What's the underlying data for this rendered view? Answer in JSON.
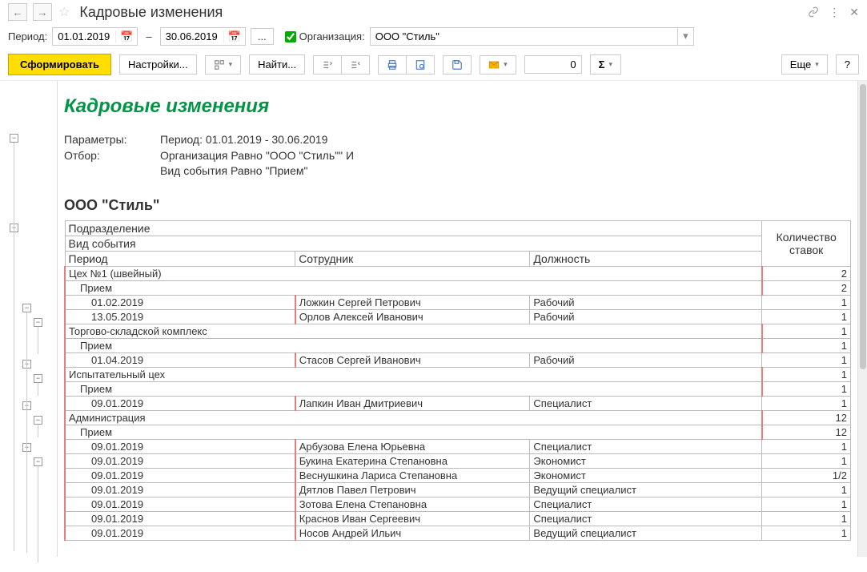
{
  "title": "Кадровые изменения",
  "period_label": "Период:",
  "date_from": "01.01.2019",
  "date_to": "30.06.2019",
  "date_sep": "–",
  "ellipsis": "...",
  "org_label": "Организация:",
  "org_value": "ООО \"Стиль\"",
  "toolbar": {
    "generate": "Сформировать",
    "settings": "Настройки...",
    "find": "Найти...",
    "num": "0",
    "more": "Еще",
    "help": "?"
  },
  "report": {
    "title": "Кадровые изменения",
    "params_label": "Параметры:",
    "params_value": "Период: 01.01.2019 - 30.06.2019",
    "filter_label": "Отбор:",
    "filter_value1": "Организация Равно \"ООО \"Стиль\"\" И",
    "filter_value2": "Вид события Равно \"Прием\"",
    "company": "ООО \"Стиль\"",
    "headers": {
      "dept": "Подразделение",
      "event": "Вид события",
      "period": "Период",
      "employee": "Сотрудник",
      "position": "Должность",
      "count": "Количество ставок"
    },
    "rows": [
      {
        "type": "dept",
        "name": "Цех №1 (швейный)",
        "count": "2"
      },
      {
        "type": "event",
        "name": "Прием",
        "count": "2"
      },
      {
        "type": "item",
        "date": "01.02.2019",
        "emp": "Ложкин Сергей Петрович",
        "pos": "Рабочий",
        "count": "1"
      },
      {
        "type": "item",
        "date": "13.05.2019",
        "emp": "Орлов Алексей Иванович",
        "pos": "Рабочий",
        "count": "1"
      },
      {
        "type": "dept",
        "name": "Торгово-складской комплекс",
        "count": "1"
      },
      {
        "type": "event",
        "name": "Прием",
        "count": "1"
      },
      {
        "type": "item",
        "date": "01.04.2019",
        "emp": "Стасов Сергей Иванович",
        "pos": "Рабочий",
        "count": "1"
      },
      {
        "type": "dept",
        "name": "Испытательный цех",
        "count": "1"
      },
      {
        "type": "event",
        "name": "Прием",
        "count": "1"
      },
      {
        "type": "item",
        "date": "09.01.2019",
        "emp": "Лапкин Иван Дмитриевич",
        "pos": "Специалист",
        "count": "1"
      },
      {
        "type": "dept",
        "name": "Администрация",
        "count": "12"
      },
      {
        "type": "event",
        "name": "Прием",
        "count": "12"
      },
      {
        "type": "item",
        "date": "09.01.2019",
        "emp": "Арбузова Елена Юрьевна",
        "pos": "Специалист",
        "count": "1"
      },
      {
        "type": "item",
        "date": "09.01.2019",
        "emp": "Букина Екатерина Степановна",
        "pos": "Экономист",
        "count": "1"
      },
      {
        "type": "item",
        "date": "09.01.2019",
        "emp": "Веснушкина Лариса Степановна",
        "pos": "Экономист",
        "count": "1/2"
      },
      {
        "type": "item",
        "date": "09.01.2019",
        "emp": "Дятлов Павел Петрович",
        "pos": "Ведущий специалист",
        "count": "1"
      },
      {
        "type": "item",
        "date": "09.01.2019",
        "emp": "Зотова Елена Степановна",
        "pos": "Специалист",
        "count": "1"
      },
      {
        "type": "item",
        "date": "09.01.2019",
        "emp": "Краснов Иван Сергеевич",
        "pos": "Специалист",
        "count": "1"
      },
      {
        "type": "item",
        "date": "09.01.2019",
        "emp": "Носов Андрей Ильич",
        "pos": "Ведущий специалист",
        "count": "1"
      }
    ]
  }
}
